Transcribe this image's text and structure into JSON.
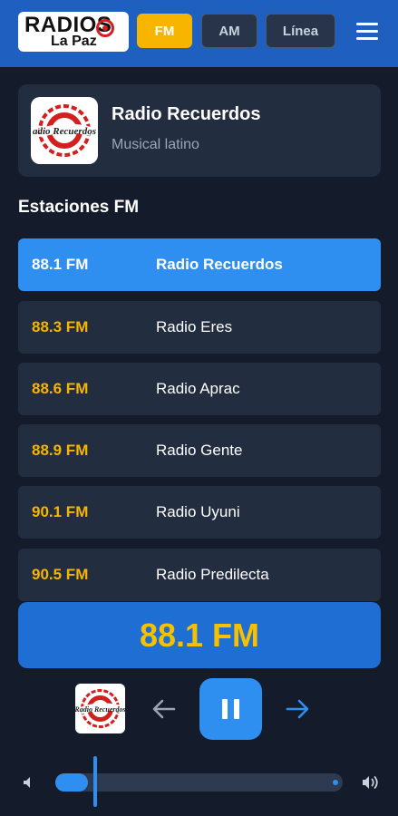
{
  "header": {
    "logo_line1": "RADIOS",
    "logo_line2": "La Paz",
    "tabs": [
      {
        "label": "FM",
        "active": true
      },
      {
        "label": "AM",
        "active": false
      },
      {
        "label": "Línea",
        "active": false
      }
    ],
    "menu_icon": "hamburger-menu-icon"
  },
  "now_playing": {
    "logo_text": "Radio Recuerdos",
    "title": "Radio Recuerdos",
    "subtitle": "Musical latino"
  },
  "section": {
    "title": "Estaciones FM"
  },
  "stations": [
    {
      "freq": "88.1 FM",
      "name": "Radio Recuerdos",
      "active": true
    },
    {
      "freq": "88.3 FM",
      "name": "Radio Eres",
      "active": false
    },
    {
      "freq": "88.6 FM",
      "name": "Radio Aprac",
      "active": false
    },
    {
      "freq": "88.9 FM",
      "name": "Radio Gente",
      "active": false
    },
    {
      "freq": "90.1 FM",
      "name": "Radio Uyuni",
      "active": false
    },
    {
      "freq": "90.5 FM",
      "name": "Radio Predilecta",
      "active": false
    }
  ],
  "player": {
    "frequency": "88.1 FM",
    "volume_level": 0.12,
    "state": "playing"
  },
  "colors": {
    "accent_blue": "#2f8ff0",
    "accent_yellow": "#f7b500",
    "header_blue": "#1f5fbf",
    "background": "#141c2b",
    "card": "#222d40"
  }
}
